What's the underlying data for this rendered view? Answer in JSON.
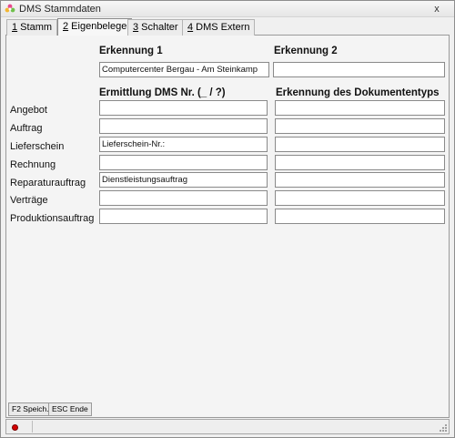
{
  "window": {
    "title": "DMS Stammdaten",
    "close_label": "x"
  },
  "tabs": [
    {
      "hotkey": "1",
      "label": " Stamm"
    },
    {
      "hotkey": "2",
      "label": " Eigenbelege"
    },
    {
      "hotkey": "3",
      "label": " Schalter"
    },
    {
      "hotkey": "4",
      "label": " DMS Extern"
    }
  ],
  "active_tab": "2 Eigenbelege",
  "headers": {
    "erkennung1": "Erkennung 1",
    "erkennung2": "Erkennung 2",
    "ermittlung": "Ermittlung DMS Nr. (_ / ?)",
    "erkennung_typ": "Erkennung des Dokumententyps"
  },
  "fields": {
    "erkennung1": "Computercenter Bergau - Am Steinkamp",
    "erkennung2": ""
  },
  "rows": [
    {
      "label": "Angebot",
      "dms_nr": "",
      "doktyp": ""
    },
    {
      "label": "Auftrag",
      "dms_nr": "",
      "doktyp": ""
    },
    {
      "label": "Lieferschein",
      "dms_nr": "Lieferschein-Nr.:",
      "doktyp": ""
    },
    {
      "label": "Rechnung",
      "dms_nr": "",
      "doktyp": ""
    },
    {
      "label": "Reparaturauftrag",
      "dms_nr": "Dienstleistungsauftrag",
      "doktyp": ""
    },
    {
      "label": "Verträge",
      "dms_nr": "",
      "doktyp": ""
    },
    {
      "label": "Produktionsauftrag",
      "dms_nr": "",
      "doktyp": ""
    }
  ],
  "buttons": {
    "save": "F2 Speich.",
    "exit": "ESC Ende"
  },
  "status": {
    "indicator_color": "#d40000"
  },
  "icons": {
    "app": "flower-app-icon",
    "close": "close-icon",
    "status": "red-dot-icon",
    "grip": "resize-grip-icon"
  }
}
